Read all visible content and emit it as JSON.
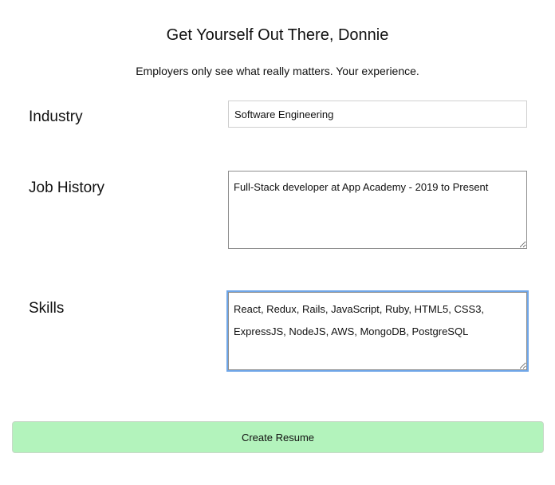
{
  "header": {
    "title": "Get Yourself Out There, Donnie",
    "subtitle": "Employers only see what really matters. Your experience."
  },
  "form": {
    "industry": {
      "label": "Industry",
      "value": "Software Engineering"
    },
    "job_history": {
      "label": "Job History",
      "value": "Full-Stack developer at App Academy - 2019 to Present"
    },
    "skills": {
      "label": "Skills",
      "value": "React, Redux, Rails, JavaScript, Ruby, HTML5, CSS3, ExpressJS, NodeJS, AWS, MongoDB, PostgreSQL"
    },
    "submit_label": "Create Resume"
  },
  "colors": {
    "submit_bg": "#b3f3bc",
    "focus_ring": "#6fa6e8"
  }
}
